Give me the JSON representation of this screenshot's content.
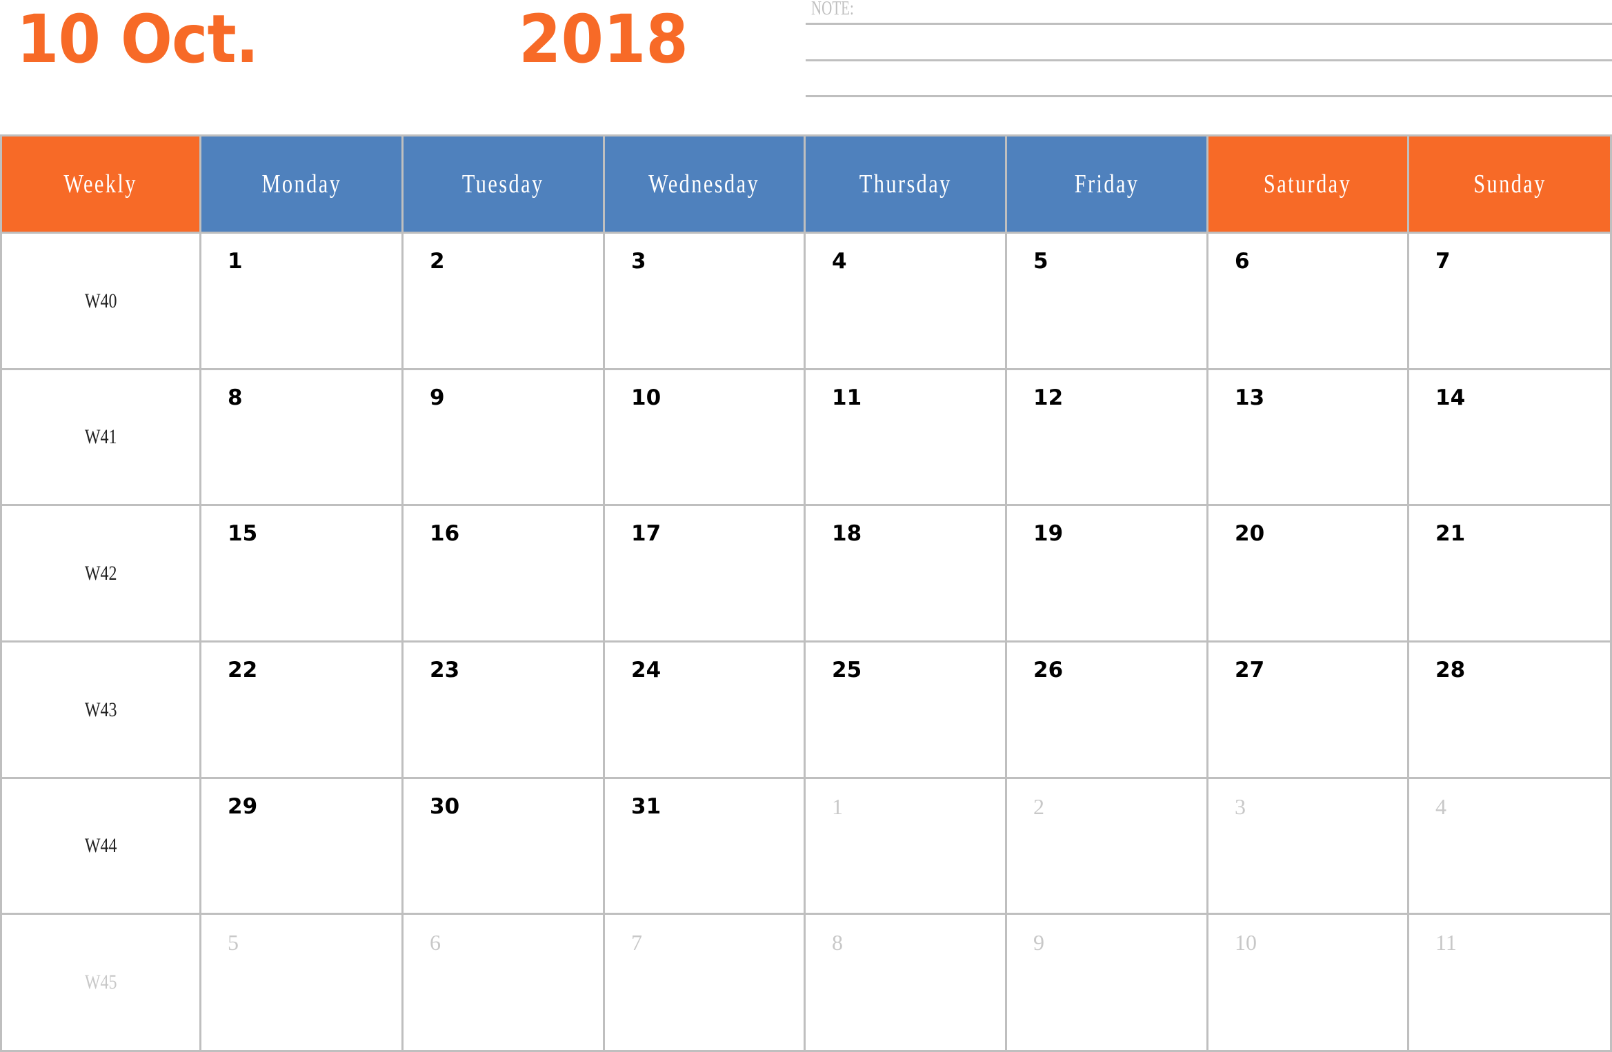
{
  "header": {
    "month_label": "10 Oct.",
    "year": "2018",
    "note_label": "NOTE:"
  },
  "colors": {
    "accent_orange": "#F76A27",
    "weekday_blue": "#4F81BD",
    "border_gray": "#BFBFBF",
    "muted_text": "#C8C8C8"
  },
  "columns": [
    {
      "label": "Weekly",
      "style": "orange"
    },
    {
      "label": "Monday",
      "style": "blue"
    },
    {
      "label": "Tuesday",
      "style": "blue"
    },
    {
      "label": "Wednesday",
      "style": "blue"
    },
    {
      "label": "Thursday",
      "style": "blue"
    },
    {
      "label": "Friday",
      "style": "blue"
    },
    {
      "label": "Saturday",
      "style": "orange"
    },
    {
      "label": "Sunday",
      "style": "orange"
    }
  ],
  "weeks": [
    {
      "week": "W40",
      "week_muted": false,
      "days": [
        {
          "n": "1",
          "muted": false
        },
        {
          "n": "2",
          "muted": false
        },
        {
          "n": "3",
          "muted": false
        },
        {
          "n": "4",
          "muted": false
        },
        {
          "n": "5",
          "muted": false
        },
        {
          "n": "6",
          "muted": false
        },
        {
          "n": "7",
          "muted": false
        }
      ]
    },
    {
      "week": "W41",
      "week_muted": false,
      "days": [
        {
          "n": "8",
          "muted": false
        },
        {
          "n": "9",
          "muted": false
        },
        {
          "n": "10",
          "muted": false
        },
        {
          "n": "11",
          "muted": false
        },
        {
          "n": "12",
          "muted": false
        },
        {
          "n": "13",
          "muted": false
        },
        {
          "n": "14",
          "muted": false
        }
      ]
    },
    {
      "week": "W42",
      "week_muted": false,
      "days": [
        {
          "n": "15",
          "muted": false
        },
        {
          "n": "16",
          "muted": false
        },
        {
          "n": "17",
          "muted": false
        },
        {
          "n": "18",
          "muted": false
        },
        {
          "n": "19",
          "muted": false
        },
        {
          "n": "20",
          "muted": false
        },
        {
          "n": "21",
          "muted": false
        }
      ]
    },
    {
      "week": "W43",
      "week_muted": false,
      "days": [
        {
          "n": "22",
          "muted": false
        },
        {
          "n": "23",
          "muted": false
        },
        {
          "n": "24",
          "muted": false
        },
        {
          "n": "25",
          "muted": false
        },
        {
          "n": "26",
          "muted": false
        },
        {
          "n": "27",
          "muted": false
        },
        {
          "n": "28",
          "muted": false
        }
      ]
    },
    {
      "week": "W44",
      "week_muted": false,
      "days": [
        {
          "n": "29",
          "muted": false
        },
        {
          "n": "30",
          "muted": false
        },
        {
          "n": "31",
          "muted": false
        },
        {
          "n": "1",
          "muted": true
        },
        {
          "n": "2",
          "muted": true
        },
        {
          "n": "3",
          "muted": true
        },
        {
          "n": "4",
          "muted": true
        }
      ]
    },
    {
      "week": "W45",
      "week_muted": true,
      "days": [
        {
          "n": "5",
          "muted": true
        },
        {
          "n": "6",
          "muted": true
        },
        {
          "n": "7",
          "muted": true
        },
        {
          "n": "8",
          "muted": true
        },
        {
          "n": "9",
          "muted": true
        },
        {
          "n": "10",
          "muted": true
        },
        {
          "n": "11",
          "muted": true
        }
      ]
    }
  ]
}
